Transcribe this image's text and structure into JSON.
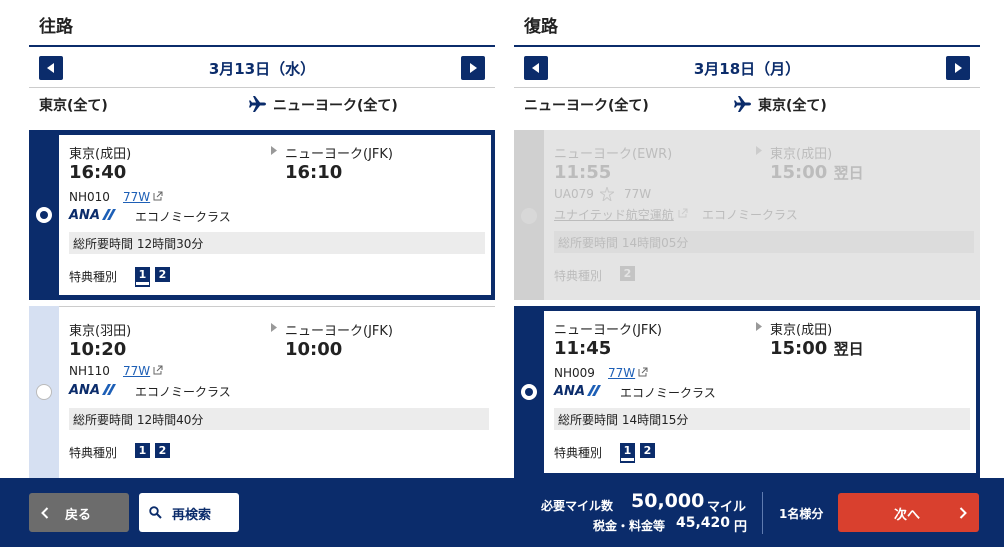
{
  "outbound": {
    "title": "往路",
    "date": "3月13日（水）",
    "route_from": "東京(全て)",
    "route_to": "ニューヨーク(全て)",
    "flights": [
      {
        "dep_airport": "東京(成田)",
        "arr_airport": "ニューヨーク(JFK)",
        "dep_time": "16:40",
        "arr_time": "16:10",
        "arr_next_day": "",
        "flight_no": "NH010",
        "aircraft": "77W",
        "airline": "ANA",
        "cabin": "エコノミークラス",
        "duration": "総所要時間 12時間30分",
        "award_label": "特典種別",
        "award_types": [
          "1",
          "2"
        ],
        "selected": true
      },
      {
        "dep_airport": "東京(羽田)",
        "arr_airport": "ニューヨーク(JFK)",
        "dep_time": "10:20",
        "arr_time": "10:00",
        "arr_next_day": "",
        "flight_no": "NH110",
        "aircraft": "77W",
        "airline": "ANA",
        "cabin": "エコノミークラス",
        "duration": "総所要時間 12時間40分",
        "award_label": "特典種別",
        "award_types": [
          "1",
          "2"
        ],
        "selected": false
      }
    ]
  },
  "return": {
    "title": "復路",
    "date": "3月18日（月）",
    "route_from": "ニューヨーク(全て)",
    "route_to": "東京(全て)",
    "flights": [
      {
        "dep_airport": "ニューヨーク(EWR)",
        "arr_airport": "東京(成田)",
        "dep_time": "11:55",
        "arr_time": "15:00",
        "arr_next_day": "翌日",
        "flight_no": "UA079",
        "aircraft": "77W",
        "airline": "ユナイテッド航空運航",
        "cabin": "エコノミークラス",
        "duration": "総所要時間 14時間05分",
        "award_label": "特典種別",
        "award_types": [
          "2"
        ],
        "selected": false,
        "disabled": true
      },
      {
        "dep_airport": "ニューヨーク(JFK)",
        "arr_airport": "東京(成田)",
        "dep_time": "11:45",
        "arr_time": "15:00",
        "arr_next_day": "翌日",
        "flight_no": "NH009",
        "aircraft": "77W",
        "airline": "ANA",
        "cabin": "エコノミークラス",
        "duration": "総所要時間 14時間15分",
        "award_label": "特典種別",
        "award_types": [
          "1",
          "2"
        ],
        "selected": true
      }
    ]
  },
  "footer": {
    "back_label": "戻る",
    "search_label": "再検索",
    "miles_label": "必要マイル数",
    "miles_value": "50,000",
    "miles_unit": "マイル",
    "tax_label": "税金・料金等",
    "tax_value": "45,420",
    "tax_unit": "円",
    "pax_label": "1名様分",
    "next_label": "次へ"
  },
  "colors": {
    "navy": "#0b2c6b",
    "next_button": "#d9402e",
    "back_button": "#6c6c6c"
  }
}
